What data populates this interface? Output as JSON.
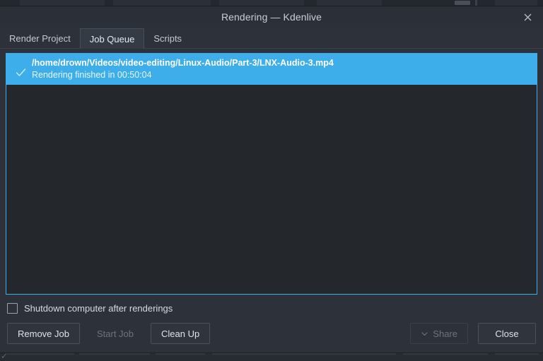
{
  "window": {
    "title": "Rendering — Kdenlive",
    "close_icon": "close-icon"
  },
  "tabs": [
    {
      "label": "Render Project",
      "active": false
    },
    {
      "label": "Job Queue",
      "active": true
    },
    {
      "label": "Scripts",
      "active": false
    }
  ],
  "job_queue": {
    "items": [
      {
        "status_icon": "checkmark-icon",
        "path": "/home/drown/Videos/video-editing/Linux-Audio/Part-3/LNX-Audio-3.mp4",
        "status": "Rendering finished in 00:50:04",
        "selected": true
      }
    ]
  },
  "options": {
    "shutdown_label": "Shutdown computer after renderings",
    "shutdown_checked": false
  },
  "buttons": {
    "remove_job": "Remove Job",
    "start_job": "Start Job",
    "clean_up": "Clean Up",
    "share": "Share",
    "close": "Close"
  },
  "colors": {
    "accent": "#3daee9",
    "dialog_bg": "#2c313a",
    "list_bg": "#24272b",
    "titlebar_bg": "#2b3038",
    "text": "#d6dae0",
    "disabled_text": "#6d747e"
  }
}
